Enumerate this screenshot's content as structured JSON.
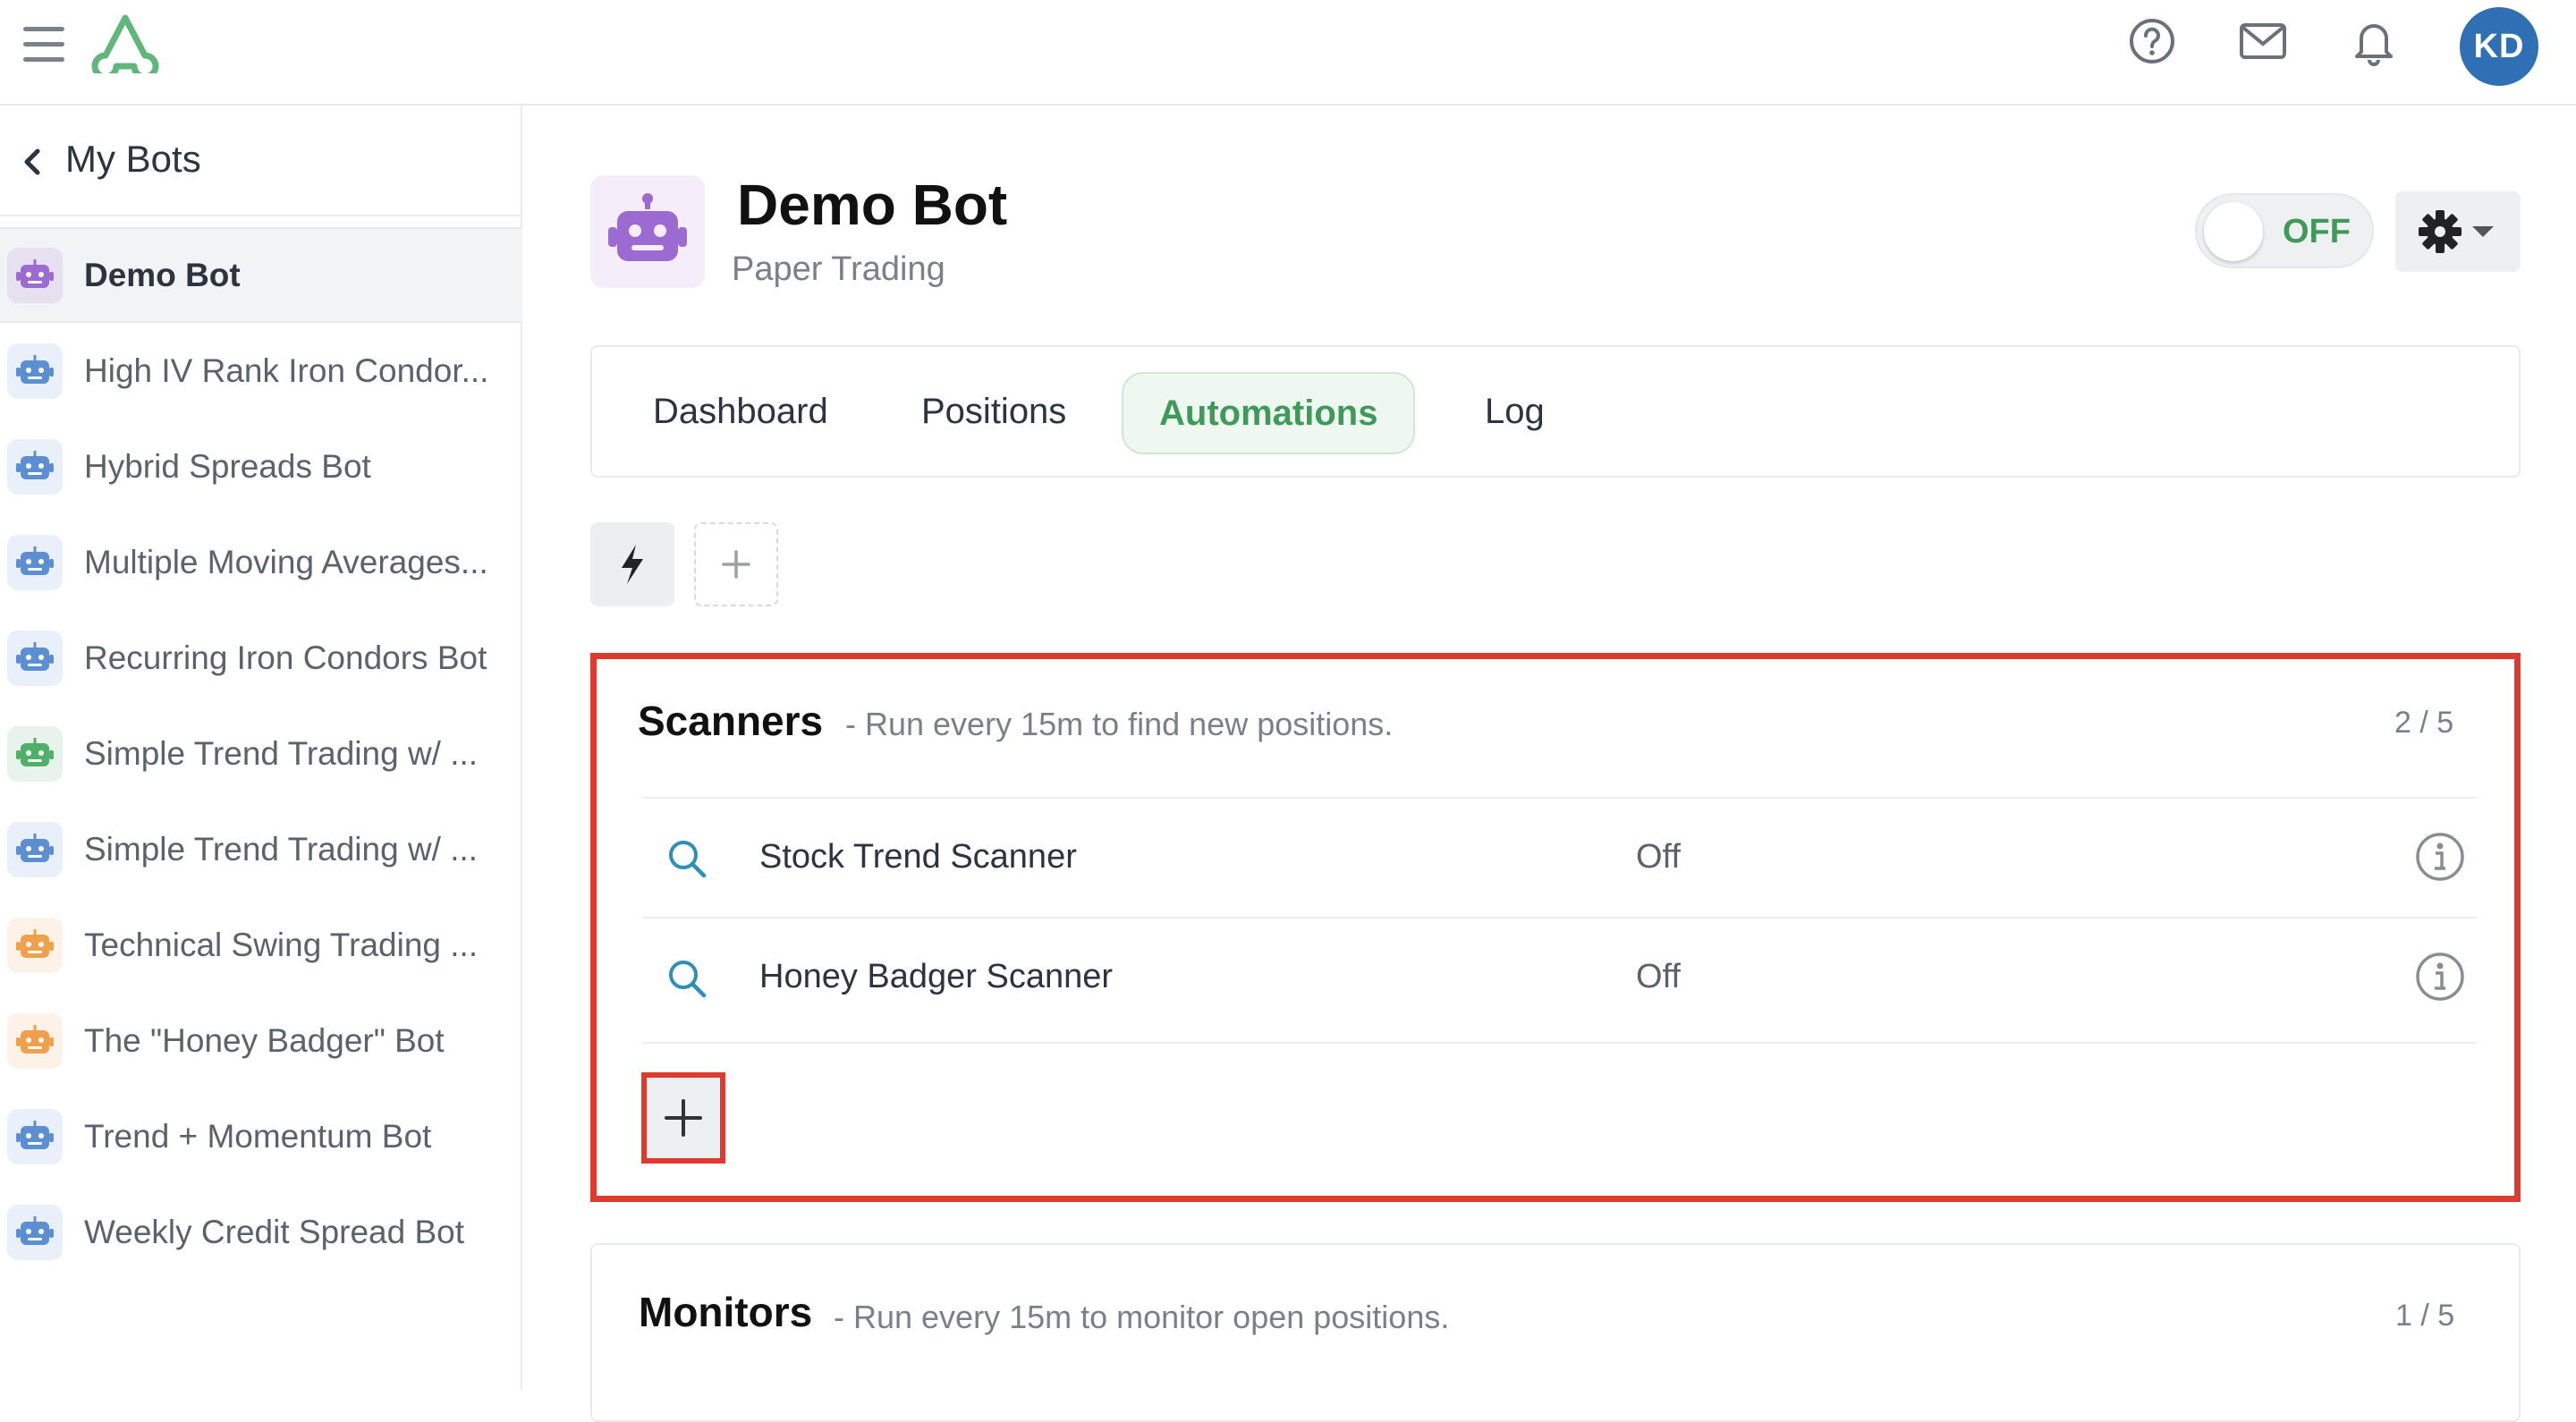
{
  "header": {
    "avatar_initials": "KD",
    "icons": [
      "menu-icon",
      "logo",
      "help-icon",
      "mail-icon",
      "bell-icon"
    ]
  },
  "sidebar": {
    "back_label": "My Bots",
    "items": [
      {
        "label": "Demo Bot",
        "icon_color": "#9b6bd1",
        "active": true
      },
      {
        "label": "High IV Rank Iron Condor...",
        "icon_color": "#5b8fd1"
      },
      {
        "label": "Hybrid Spreads Bot",
        "icon_color": "#5b8fd1"
      },
      {
        "label": "Multiple Moving Averages...",
        "icon_color": "#5b8fd1"
      },
      {
        "label": "Recurring Iron Condors Bot",
        "icon_color": "#5b8fd1"
      },
      {
        "label": "Simple Trend Trading w/ ...",
        "icon_color": "#4fb06a"
      },
      {
        "label": "Simple Trend Trading w/ ...",
        "icon_color": "#5b8fd1"
      },
      {
        "label": "Technical Swing Trading ...",
        "icon_color": "#f0a04b"
      },
      {
        "label": "The \"Honey Badger\" Bot",
        "icon_color": "#f0a04b"
      },
      {
        "label": "Trend + Momentum Bot",
        "icon_color": "#5b8fd1"
      },
      {
        "label": "Weekly Credit Spread Bot",
        "icon_color": "#5b8fd1"
      }
    ]
  },
  "bot": {
    "title": "Demo Bot",
    "subtitle": "Paper Trading",
    "toggle_label": "OFF"
  },
  "tabs": [
    {
      "label": "Dashboard"
    },
    {
      "label": "Positions"
    },
    {
      "label": "Automations",
      "active": true
    },
    {
      "label": "Log"
    }
  ],
  "scanners": {
    "title": "Scanners",
    "description": "- Run every 15m to find new positions.",
    "count": "2 / 5",
    "rows": [
      {
        "name": "Stock Trend Scanner",
        "status": "Off"
      },
      {
        "name": "Honey Badger Scanner",
        "status": "Off"
      }
    ]
  },
  "monitors": {
    "title": "Monitors",
    "description": "- Run every 15m to monitor open positions.",
    "count": "1 / 5"
  },
  "colors": {
    "accent_green": "#3f9a5a",
    "highlight_red": "#de3a2f",
    "avatar_blue": "#2f6fb3"
  }
}
